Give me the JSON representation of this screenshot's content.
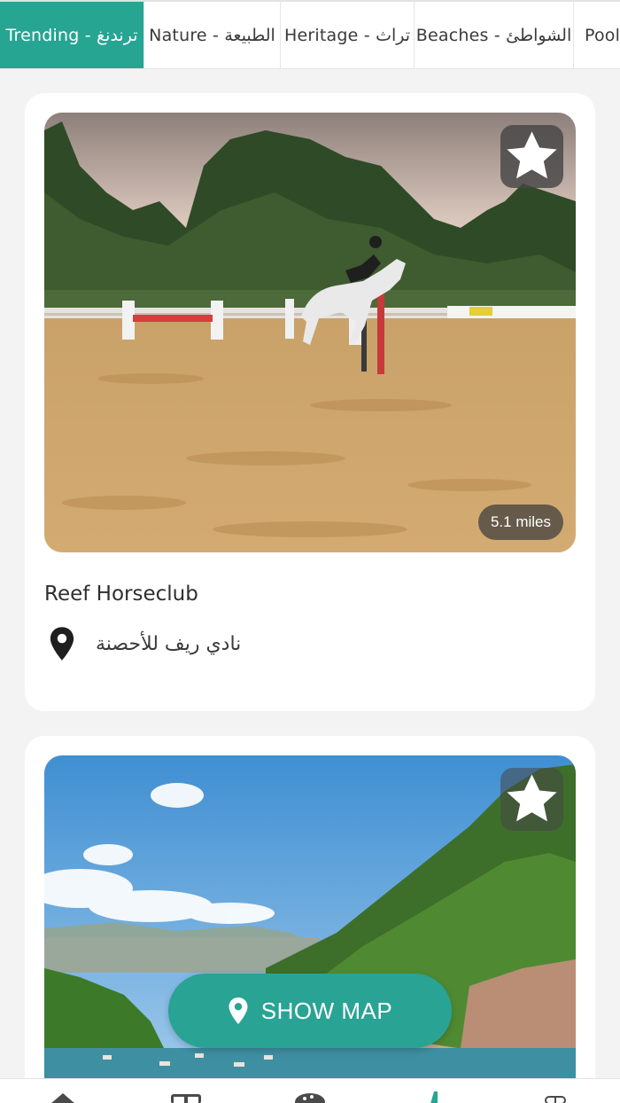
{
  "tabs": [
    {
      "label": "Trending - ترندنغ",
      "active": true
    },
    {
      "label": "Nature - الطبيعة",
      "active": false
    },
    {
      "label": "Heritage - تراث",
      "active": false
    },
    {
      "label": "Beaches - الشواطئ",
      "active": false
    },
    {
      "label": "Pools",
      "active": false
    }
  ],
  "listings": [
    {
      "title": "Reef Horseclub",
      "location": "نادي ريف للأحصنة",
      "distance": "5.1 miles",
      "favorite_icon": "star-icon"
    },
    {
      "favorite_icon": "star-icon"
    }
  ],
  "map_button": {
    "label": "SHOW MAP",
    "icon": "map-pin-icon"
  },
  "bottom_nav": {
    "icons": [
      "home-icon",
      "book-icon",
      "discover-icon",
      "activity-icon",
      "more-icon"
    ],
    "accent": "#26a593"
  },
  "colors": {
    "accent": "#26a593",
    "background": "#f3f3f3"
  }
}
